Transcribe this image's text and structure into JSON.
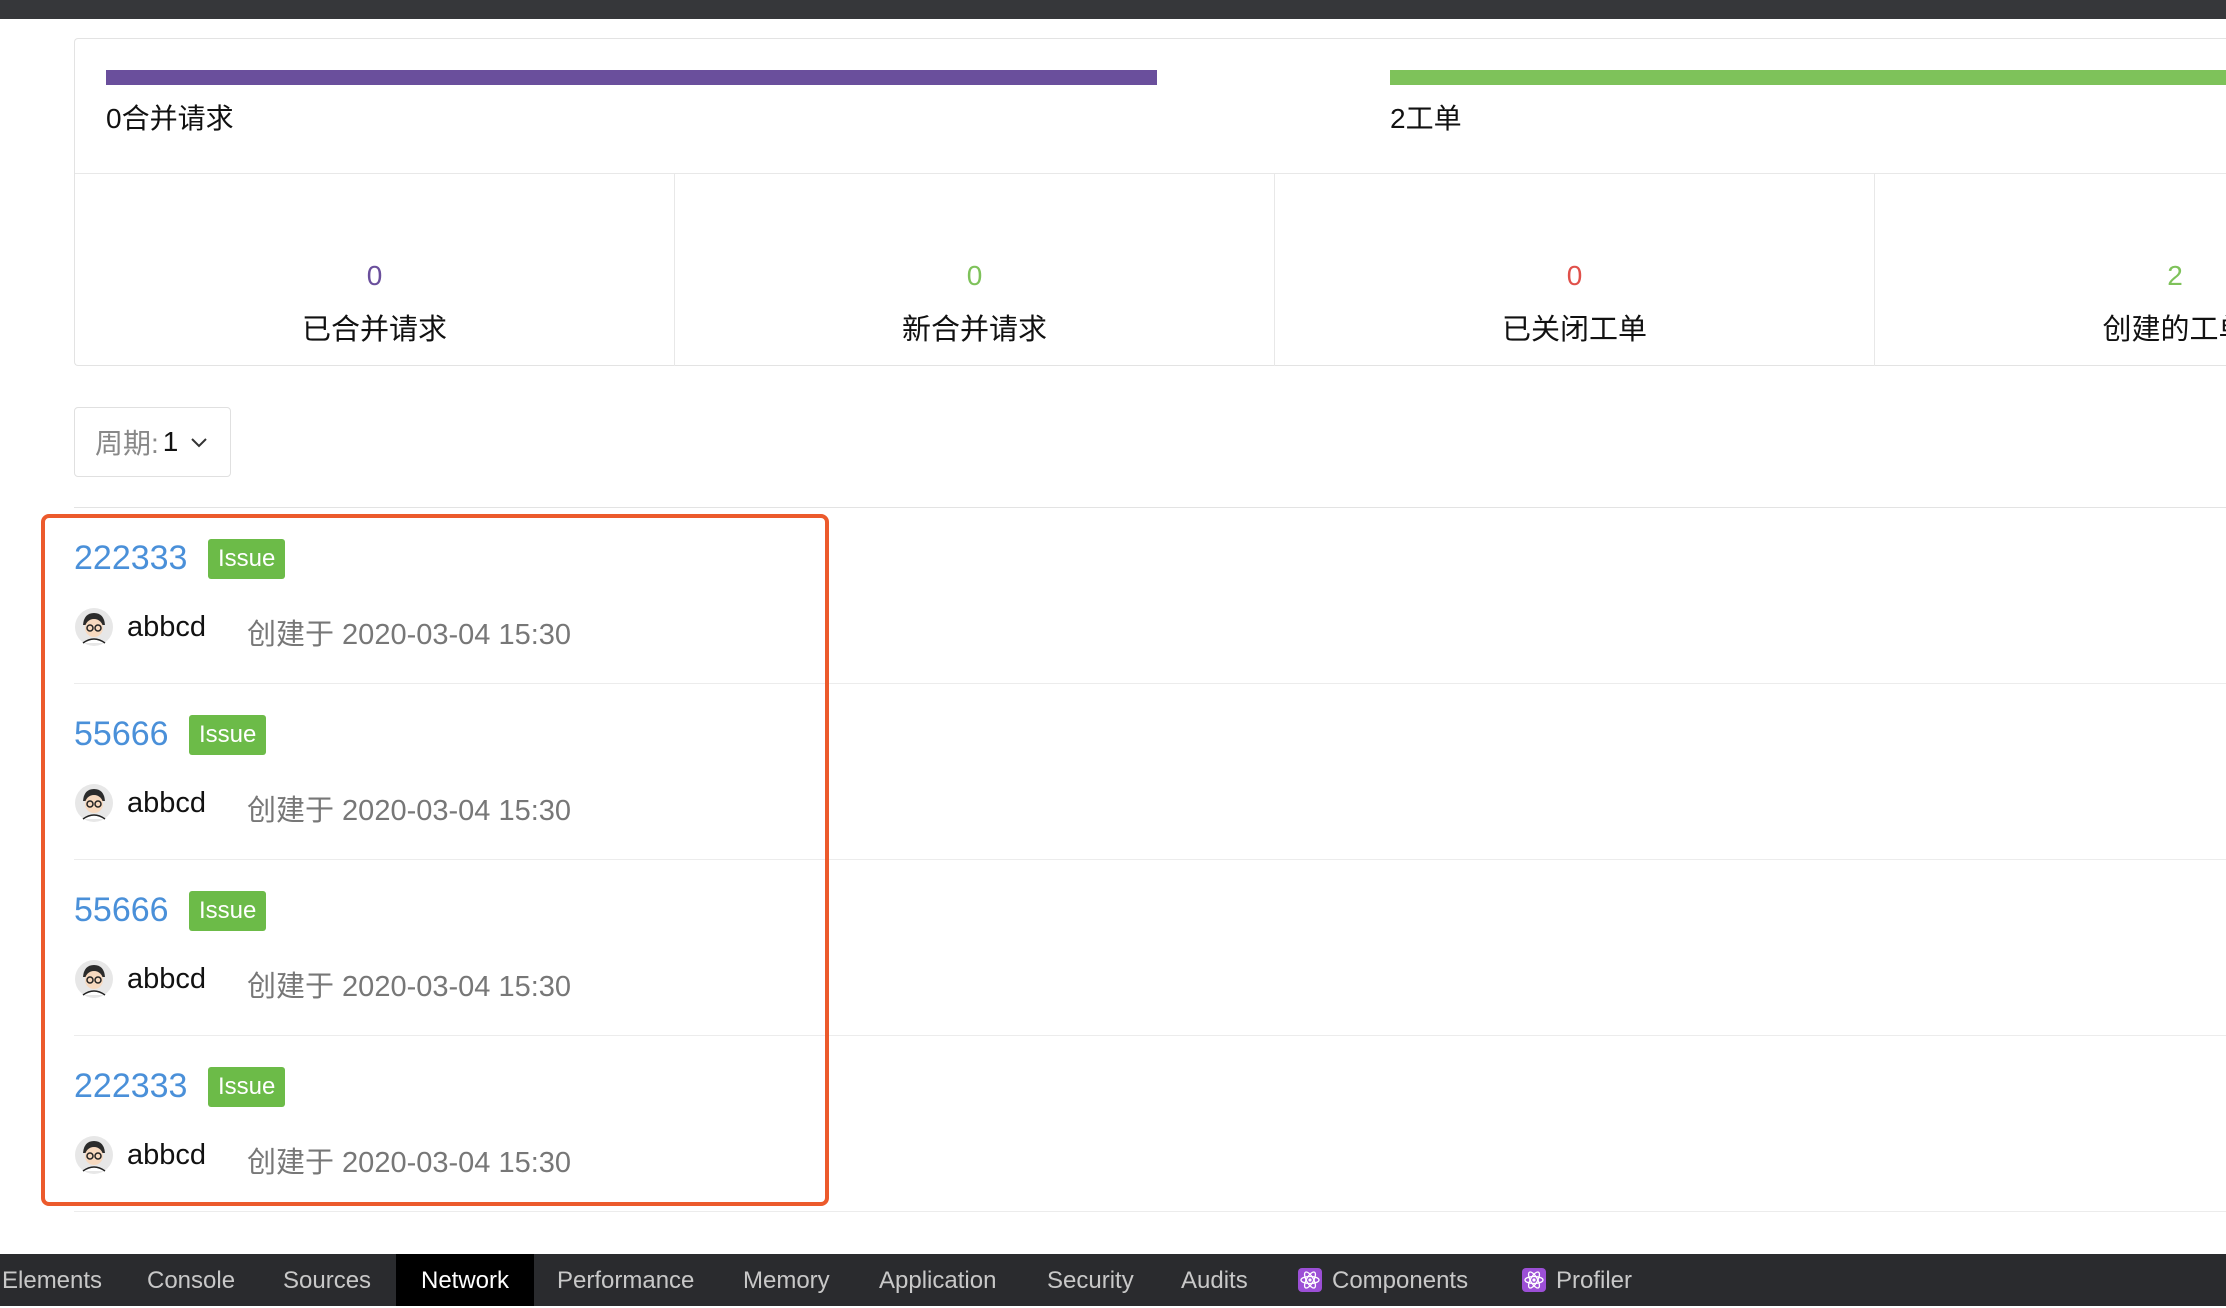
{
  "summary": {
    "mr_bar_label": "0合并请求",
    "issue_bar_label": "2工单",
    "stats": [
      {
        "value": "0",
        "label": "已合并请求",
        "color": "#6a4f9c"
      },
      {
        "value": "0",
        "label": "新合并请求",
        "color": "#7ec25a"
      },
      {
        "value": "0",
        "label": "已关闭工单",
        "color": "#e0504a"
      },
      {
        "value": "2",
        "label": "创建的工单",
        "color": "#7ec25a"
      }
    ]
  },
  "period": {
    "label": "周期:",
    "value": "1",
    "icon": "chevron-down-icon"
  },
  "items": [
    {
      "title": "222333",
      "tag": "Issue",
      "author": "abbcd",
      "created": "创建于 2020-03-04 15:30"
    },
    {
      "title": "55666",
      "tag": "Issue",
      "author": "abbcd",
      "created": "创建于 2020-03-04 15:30"
    },
    {
      "title": "55666",
      "tag": "Issue",
      "author": "abbcd",
      "created": "创建于 2020-03-04 15:30"
    },
    {
      "title": "222333",
      "tag": "Issue",
      "author": "abbcd",
      "created": "创建于 2020-03-04 15:30"
    }
  ],
  "devtools": {
    "tabs": [
      "Elements",
      "Console",
      "Sources",
      "Network",
      "Performance",
      "Memory",
      "Application",
      "Security",
      "Audits",
      "Components",
      "Profiler"
    ],
    "active": "Network"
  },
  "colors": {
    "accent_link": "#4a90d9",
    "tag_green": "#6cbb48",
    "highlight": "#ec5a2c",
    "mr_purple": "#6a4f9c",
    "issue_green": "#7ec25a"
  }
}
